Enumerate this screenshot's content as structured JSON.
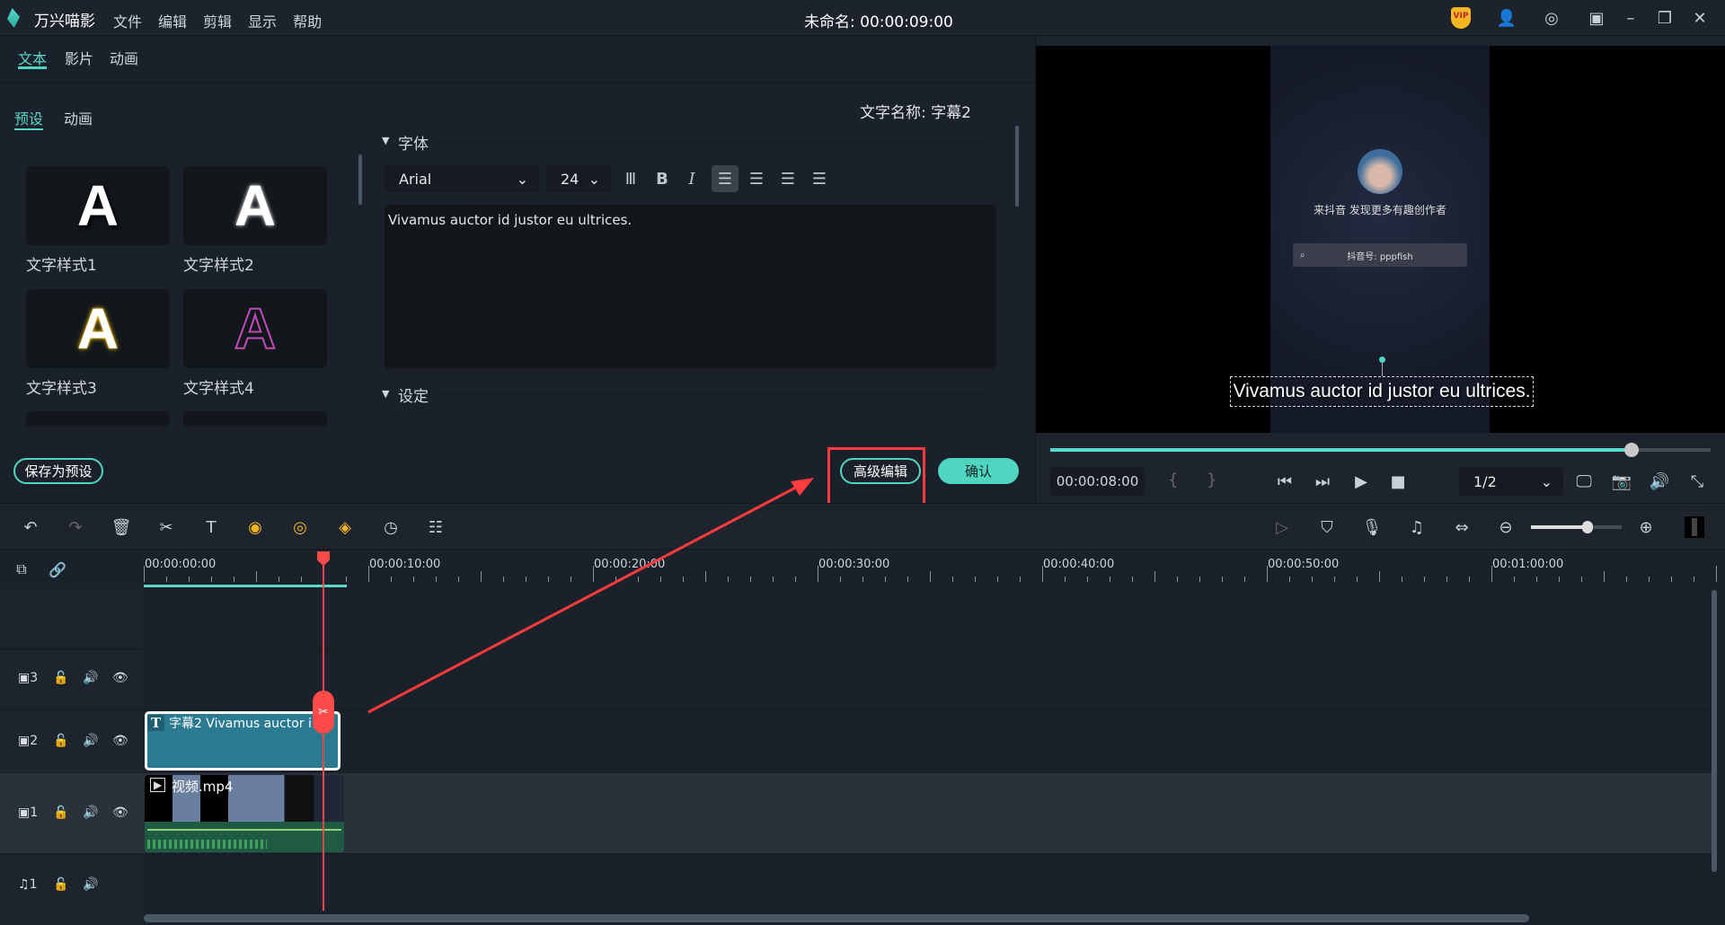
{
  "app": {
    "name": "万兴喵影",
    "menu": [
      "文件",
      "编辑",
      "剪辑",
      "显示",
      "帮助"
    ],
    "title": "未命名: 00:00:09:00",
    "vip": "VIP"
  },
  "top_tabs": [
    "文本",
    "影片",
    "动画"
  ],
  "sub_tabs": [
    "预设",
    "动画"
  ],
  "presets": [
    {
      "label": "文字样式1"
    },
    {
      "label": "文字样式2"
    },
    {
      "label": "文字样式3"
    },
    {
      "label": "文字样式4"
    }
  ],
  "preset_glyph": "A",
  "editor": {
    "name_label": "文字名称: 字幕2",
    "font_section": "字体",
    "font": "Arial",
    "size": "24",
    "text": "Vivamus auctor id justor eu ultrices.",
    "settings_section": "设定"
  },
  "buttons": {
    "save_preset": "保存为预设",
    "advanced": "高级编辑",
    "confirm": "确认"
  },
  "preview": {
    "caption": "Vivamus auctor id justor eu ultrices.",
    "promo": "来抖音 发现更多有趣创作者",
    "search": "抖音号: pppfish",
    "time": "00:00:08:00",
    "progress": 0.88,
    "brace_in": "{",
    "brace_out": "}",
    "quality": "1/2"
  },
  "timeline": {
    "ruler": [
      "00:00:00:00",
      "00:00:10:00",
      "00:00:20:00",
      "00:00:30:00",
      "00:00:40:00",
      "00:00:50:00",
      "00:01:00:00"
    ],
    "tracks": [
      {
        "id": "3"
      },
      {
        "id": "2"
      },
      {
        "id": "1"
      },
      {
        "id": "1"
      }
    ],
    "text_clip": "字幕2 Vivamus auctor i",
    "video_clip": "视频.mp4",
    "zoom": 0.62
  },
  "colors": {
    "accent": "#4fd6c0",
    "highlight": "#ff3b3b",
    "text_clip": "#2a7a92",
    "video_clip": "#1f5a42"
  }
}
